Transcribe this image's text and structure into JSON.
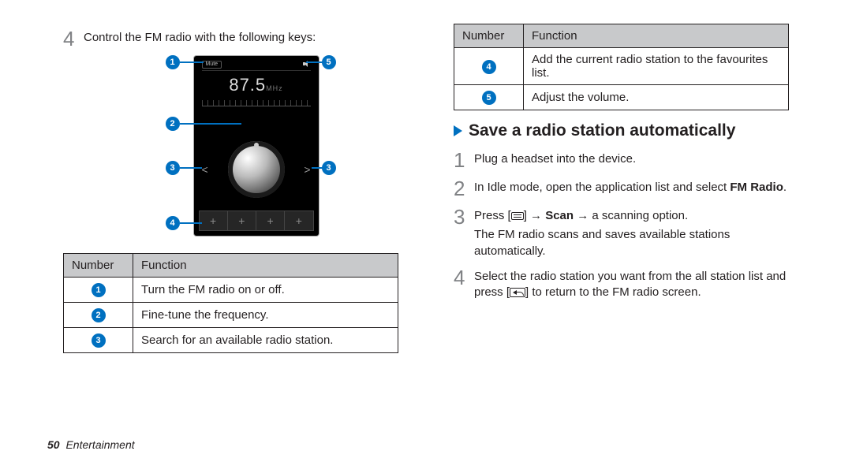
{
  "left": {
    "step4_text": "Control the FM radio with the following keys:",
    "freq": "87.5",
    "freq_unit": "MHz",
    "mute_label": "Mute",
    "callouts": {
      "c1": "1",
      "c2": "2",
      "c3l": "3",
      "c3r": "3",
      "c4": "4",
      "c5": "5"
    },
    "table_headers": {
      "num": "Number",
      "func": "Function"
    },
    "rows": [
      {
        "num": "1",
        "func": "Turn the FM radio on or off."
      },
      {
        "num": "2",
        "func": "Fine-tune the frequency."
      },
      {
        "num": "3",
        "func": "Search for an available radio station."
      }
    ]
  },
  "right": {
    "table_headers": {
      "num": "Number",
      "func": "Function"
    },
    "rows": [
      {
        "num": "4",
        "func": "Add the current radio station to the favourites list."
      },
      {
        "num": "5",
        "func": "Adjust the volume."
      }
    ],
    "heading": "Save a radio station automatically",
    "step1": "Plug a headset into the device.",
    "step2_pre": "In Idle mode, open the application list and select ",
    "step2_bold1": "FM Radio",
    "step2_post": ".",
    "step3_pre": "Press [",
    "step3_mid1": "] → ",
    "step3_bold": "Scan",
    "step3_mid2": " → a scanning option.",
    "step3_sub": "The FM radio scans and saves available stations automatically.",
    "step4_pre": "Select the radio station you want from the all station list and press [",
    "step4_post": "] to return to the FM radio screen."
  },
  "footer": {
    "page": "50",
    "section": "Entertainment"
  }
}
